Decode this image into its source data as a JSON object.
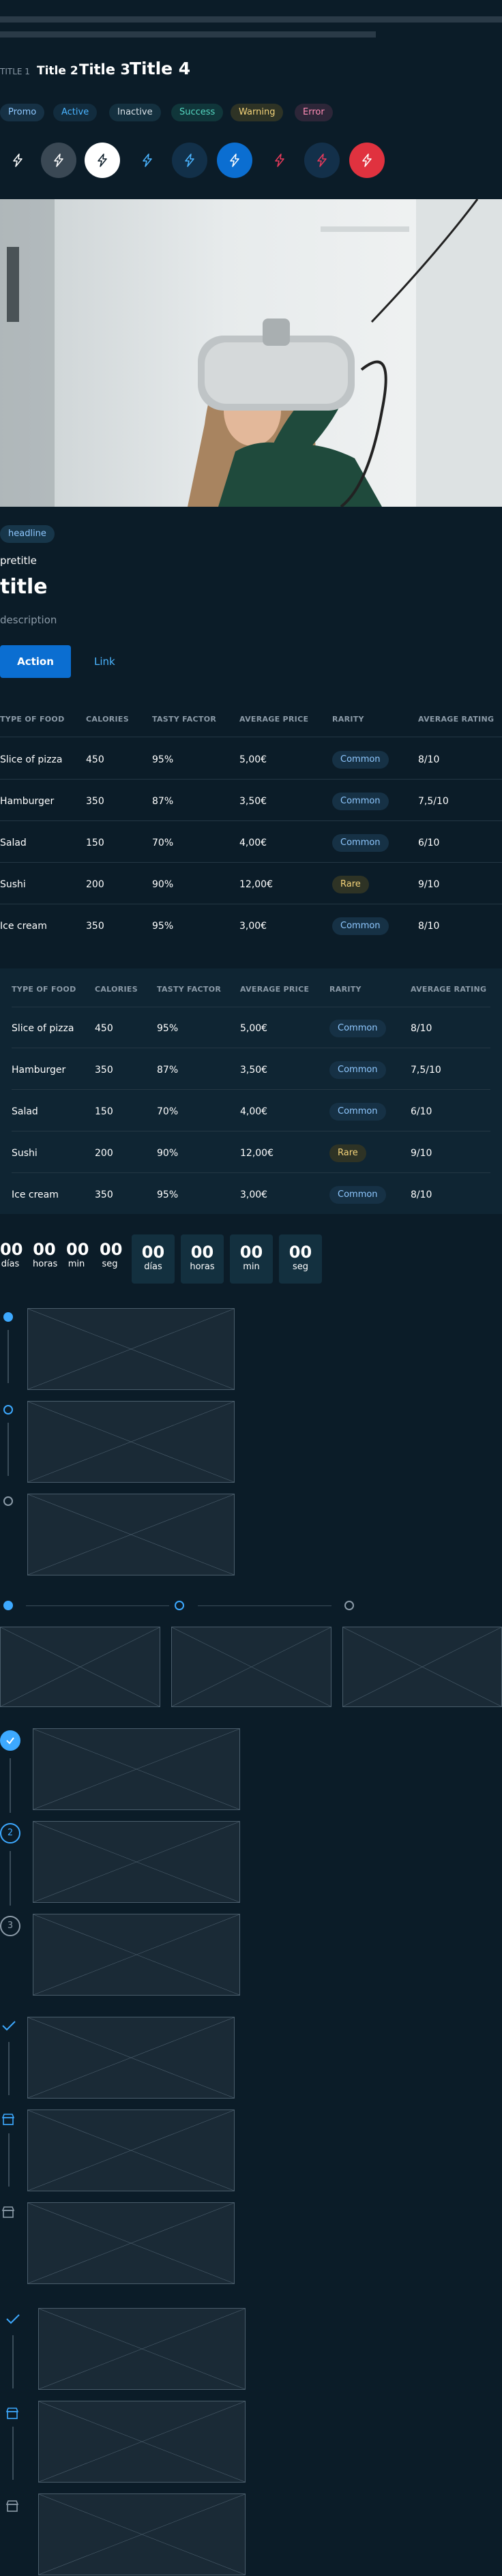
{
  "titles": {
    "title1": "TITLE 1",
    "title2": "Title 2",
    "title3": "Title 3",
    "title4": "Title 4"
  },
  "tags": [
    {
      "label": "Promo",
      "color": "#8FC8FF",
      "bg": "#163145"
    },
    {
      "label": "Active",
      "color": "#4BB4FF",
      "bg": "#122C3E"
    },
    {
      "label": "Inactive",
      "color": "#D9E1E7",
      "bg": "#14303F"
    },
    {
      "label": "Success",
      "color": "#55D6C0",
      "bg": "#10363A"
    },
    {
      "label": "Warning",
      "color": "#F5D47A",
      "bg": "#2E3325"
    },
    {
      "label": "Error",
      "color": "#FF8DB6",
      "bg": "#2D2638"
    }
  ],
  "icon_buttons": [
    {
      "icon": "lightning-icon",
      "variant": "plain-light"
    },
    {
      "icon": "lightning-icon",
      "variant": "grey-filled"
    },
    {
      "icon": "lightning-icon",
      "variant": "white-filled"
    },
    {
      "icon": "lightning-icon",
      "variant": "plain-blue"
    },
    {
      "icon": "lightning-icon",
      "variant": "dark-blue-filled"
    },
    {
      "icon": "lightning-icon",
      "variant": "blue-filled"
    },
    {
      "icon": "lightning-icon",
      "variant": "plain-red"
    },
    {
      "icon": "lightning-icon",
      "variant": "dark-red-filled"
    },
    {
      "icon": "lightning-icon",
      "variant": "red-filled"
    }
  ],
  "card": {
    "headline": "headline",
    "pretitle": "pretitle",
    "title": "title",
    "description": "description",
    "action_label": "Action",
    "link_label": "Link"
  },
  "table": {
    "headers": [
      "TYPE OF FOOD",
      "CALORIES",
      "TASTY FACTOR",
      "AVERAGE PRICE",
      "RARITY",
      "AVERAGE RATING"
    ],
    "rows": [
      [
        "Slice of pizza",
        "450",
        "95%",
        "5,00€",
        "Common",
        "8/10"
      ],
      [
        "Hamburger",
        "350",
        "87%",
        "3,50€",
        "Common",
        "7,5/10"
      ],
      [
        "Salad",
        "150",
        "70%",
        "4,00€",
        "Common",
        "6/10"
      ],
      [
        "Sushi",
        "200",
        "90%",
        "12,00€",
        "Rare",
        "9/10"
      ],
      [
        "Ice cream",
        "350",
        "95%",
        "3,00€",
        "Common",
        "8/10"
      ]
    ]
  },
  "countdown": {
    "values": [
      "00",
      "00",
      "00",
      "00"
    ],
    "labels": [
      "días",
      "horas",
      "min",
      "seg"
    ]
  },
  "colors": {
    "background": "#0B1C28",
    "accent": "#0B6ED1",
    "link": "#4BB4FF"
  }
}
